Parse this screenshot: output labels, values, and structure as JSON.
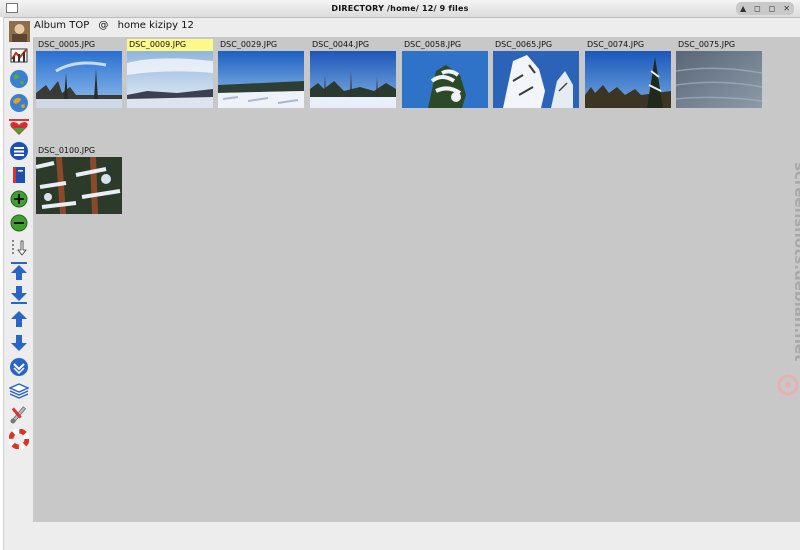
{
  "window": {
    "title": "DIRECTORY   /home/        12/  9 files",
    "controls": [
      "▲",
      "◻",
      "◻",
      "✕"
    ]
  },
  "toolbar": {
    "icons": [
      "user-avatar-icon",
      "chart-icon",
      "globe-icon",
      "globe-icon",
      "heart-icon",
      "list-icon",
      "book-icon",
      "zoom-in-icon",
      "zoom-out-icon",
      "sort-down-icon",
      "first-icon",
      "last-icon",
      "up-icon",
      "down-icon",
      "chevron-down-icon",
      "layers-icon",
      "tools-icon",
      "help-lifebuoy-icon"
    ]
  },
  "header": {
    "album": "Album TOP",
    "at": "@",
    "path": "home  kizipy 12"
  },
  "thumbnails": [
    {
      "name": "DSC_0005.JPG",
      "selected": false
    },
    {
      "name": "DSC_0009.JPG",
      "selected": true
    },
    {
      "name": "DSC_0029.JPG",
      "selected": false
    },
    {
      "name": "DSC_0044.JPG",
      "selected": false
    },
    {
      "name": "DSC_0058.JPG",
      "selected": false
    },
    {
      "name": "DSC_0065.JPG",
      "selected": false
    },
    {
      "name": "DSC_0074.JPG",
      "selected": false
    },
    {
      "name": "DSC_0075.JPG",
      "selected": false
    },
    {
      "name": "DSC_0100.JPG",
      "selected": false
    }
  ],
  "watermark": "screenshots.debian.net",
  "colors": {
    "gallery_bg": "#c8c8c8",
    "selection": "#fff98a",
    "sky_blue": "#2f73c8"
  }
}
